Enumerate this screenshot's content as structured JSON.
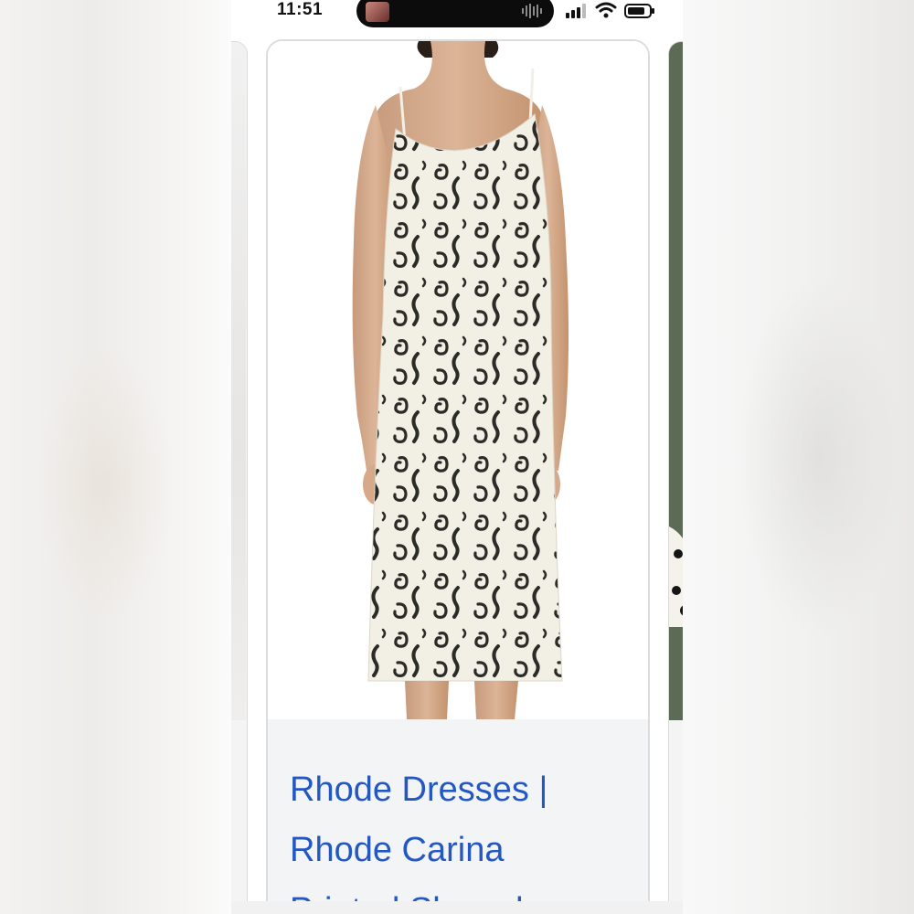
{
  "status_bar": {
    "time": "11:51"
  },
  "listing": {
    "title": "Rhode Dresses | Rhode Carina Printed Sleeveless",
    "image_alt": "Model wearing a black and white swirl print sleeveless slip midi dress"
  },
  "colors": {
    "link": "#2358c3",
    "card_text_bg": "#f3f4f6",
    "card_border": "#dcdcdc",
    "print_ink": "#2b2b28",
    "dress_base": "#f2efe4"
  },
  "icons": [
    "signal-icon",
    "wifi-icon",
    "battery-icon",
    "audio-wave-icon"
  ]
}
